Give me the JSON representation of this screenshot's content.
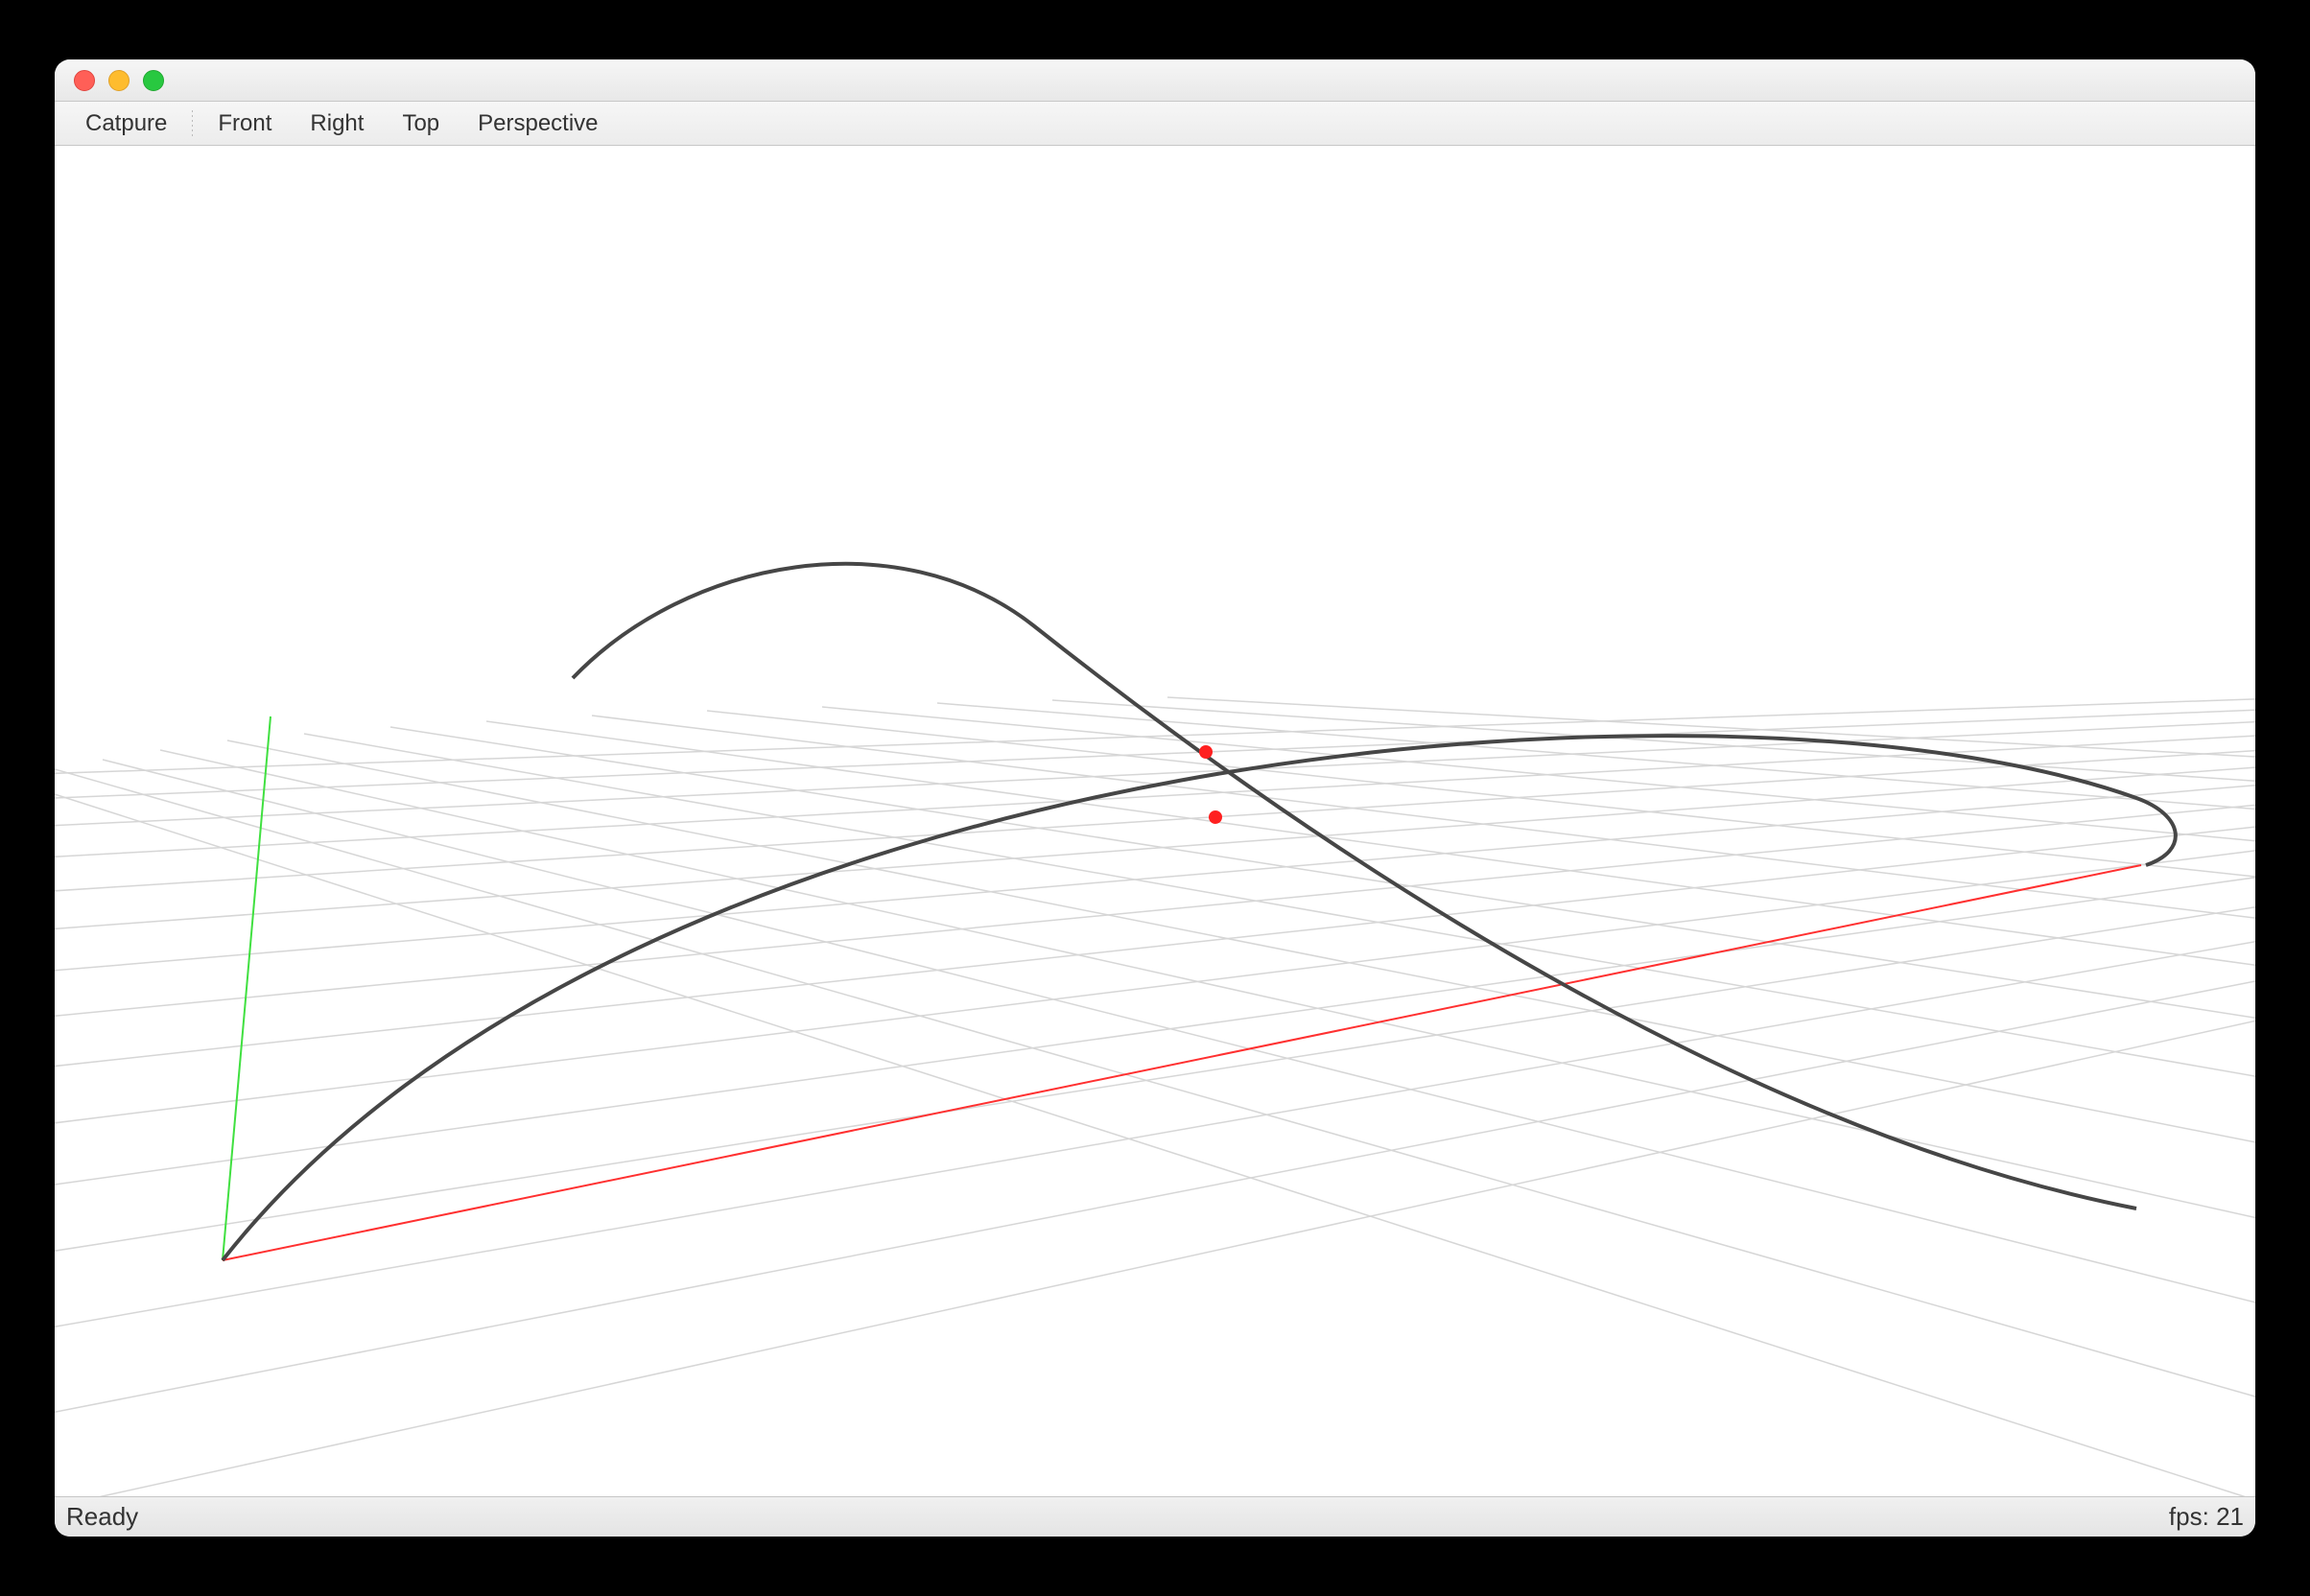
{
  "toolbar": {
    "capture": "Catpure",
    "views": [
      "Front",
      "Right",
      "Top",
      "Perspective"
    ]
  },
  "status": {
    "left": "Ready",
    "fps_label": "fps:",
    "fps_value": "21"
  },
  "colors": {
    "axis_x": "#ff3030",
    "axis_y": "#40e040",
    "grid": "#d0d0d0",
    "curve": "#464646",
    "point": "#ff2020"
  }
}
